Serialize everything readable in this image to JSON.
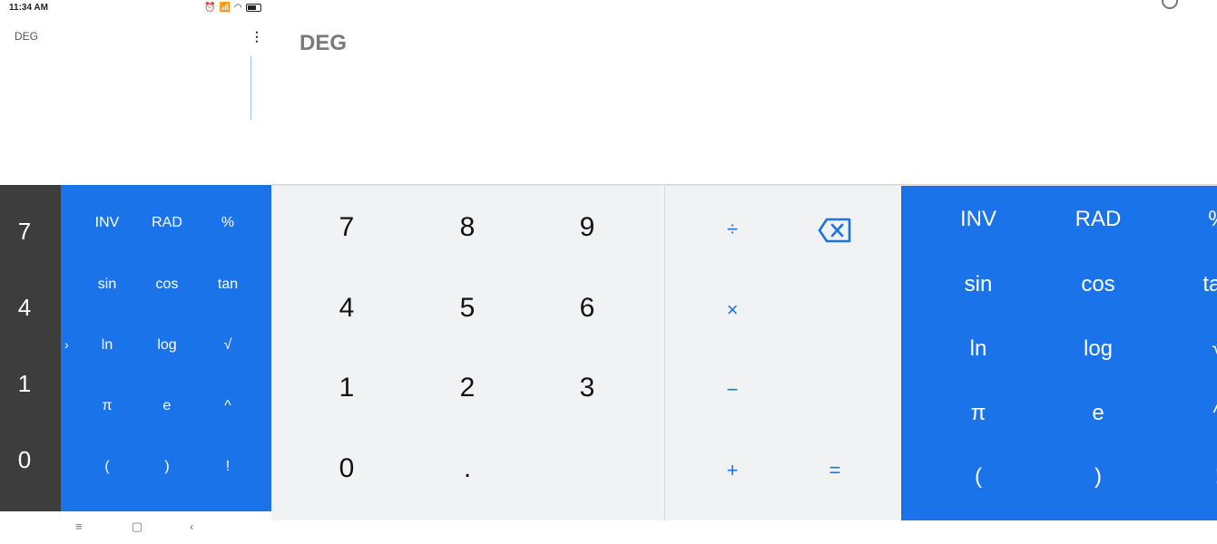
{
  "status": {
    "time": "11:34 AM"
  },
  "small_pane": {
    "mode": "DEG",
    "left_numbers": [
      "7",
      "4",
      "1",
      "0"
    ],
    "sci_buttons": [
      [
        "INV",
        "RAD",
        "%"
      ],
      [
        "sin",
        "cos",
        "tan"
      ],
      [
        "ln",
        "log",
        "√"
      ],
      [
        "π",
        "e",
        "^"
      ],
      [
        "(",
        ")",
        "!"
      ]
    ],
    "chevron": "›",
    "nav": {
      "menu": "≡",
      "home": "▢",
      "back": "‹"
    }
  },
  "main_pane": {
    "mode": "DEG",
    "numpad": [
      [
        "7",
        "8",
        "9"
      ],
      [
        "4",
        "5",
        "6"
      ],
      [
        "1",
        "2",
        "3"
      ],
      [
        "0",
        ".",
        ""
      ]
    ],
    "ops": {
      "divide": "÷",
      "multiply": "×",
      "minus": "−",
      "plus": "+",
      "equals": "="
    },
    "sci_buttons": [
      [
        "INV",
        "RAD",
        "%"
      ],
      [
        "sin",
        "cos",
        "tan"
      ],
      [
        "ln",
        "log",
        "√"
      ],
      [
        "π",
        "e",
        "^"
      ],
      [
        "(",
        ")",
        "!"
      ]
    ]
  },
  "colors": {
    "accent": "#1a73e8",
    "dark": "#3c3d3c",
    "pad": "#f1f2f4"
  }
}
